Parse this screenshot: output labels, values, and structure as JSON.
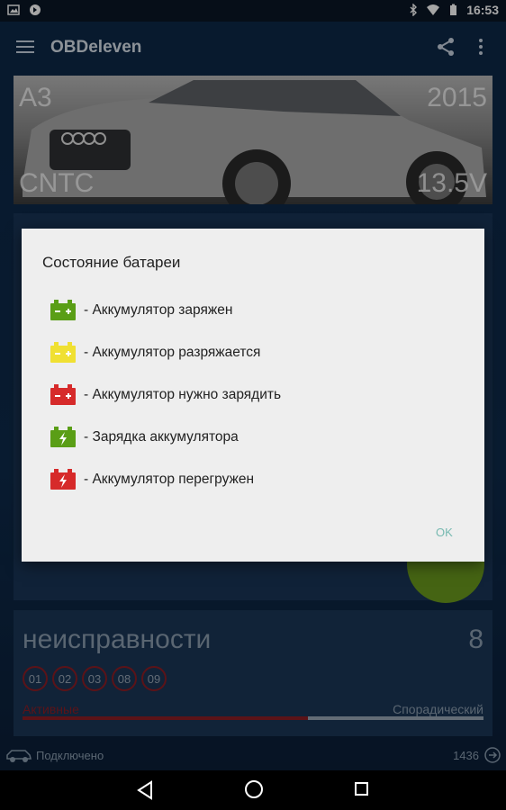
{
  "status_bar": {
    "time": "16:53"
  },
  "toolbar": {
    "title": "OBDeleven"
  },
  "vehicle": {
    "model": "A3",
    "year": "2015",
    "engine": "CNTC",
    "voltage": "13.5V"
  },
  "faults": {
    "title": "неисправности",
    "count": "8",
    "codes": [
      "01",
      "02",
      "03",
      "08",
      "09"
    ],
    "left_label": "Активные",
    "right_label": "Спорадический",
    "progress_fraction": 0.62
  },
  "footer": {
    "connection": "Подключено",
    "number": "1436"
  },
  "dialog": {
    "title": "Состояние батареи",
    "items": [
      {
        "icon": "battery-charged-icon",
        "color": "#5a9e16",
        "symbol": "plus-minus",
        "text": "- Аккумулятор заряжен"
      },
      {
        "icon": "battery-discharging-icon",
        "color": "#f0e032",
        "symbol": "plus-minus",
        "text": "- Аккумулятор разряжается"
      },
      {
        "icon": "battery-needs-charge-icon",
        "color": "#d62a2a",
        "symbol": "plus-minus",
        "text": "- Аккумулятор нужно зарядить"
      },
      {
        "icon": "battery-charging-icon",
        "color": "#5a9e16",
        "symbol": "bolt",
        "text": "- Зарядка аккумулятора"
      },
      {
        "icon": "battery-overloaded-icon",
        "color": "#d62a2a",
        "symbol": "bolt",
        "text": "- Аккумулятор перегружен"
      }
    ],
    "ok_label": "OK"
  }
}
